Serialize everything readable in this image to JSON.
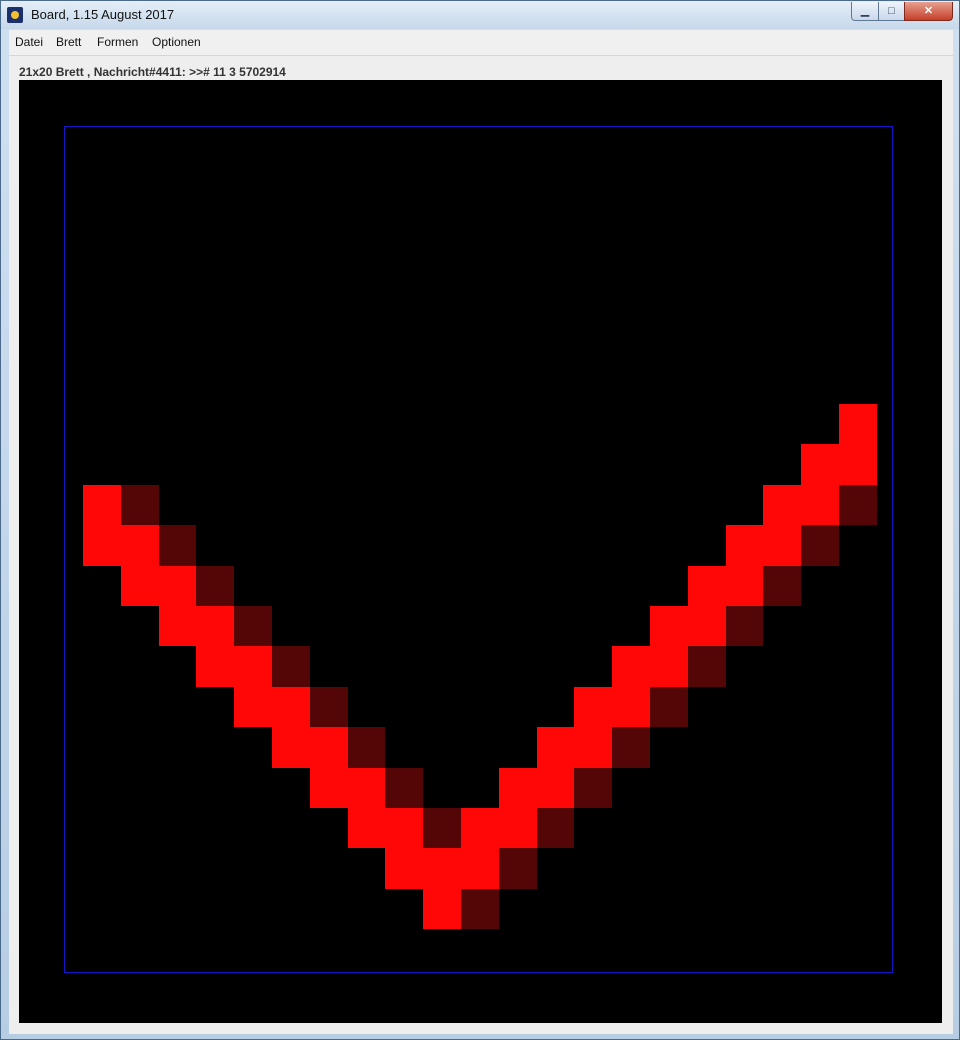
{
  "window": {
    "title": "Board, 1.15 August 2017",
    "controls": {
      "minimize": "▁",
      "maximize": "□",
      "close": "✕"
    }
  },
  "menu": [
    "Datei",
    "Brett",
    "Formen",
    "Optionen"
  ],
  "status": "21x20 Brett , Nachricht#4411: >># 11 3 5702914",
  "board": {
    "columns": 21,
    "rows": 20,
    "background": "#000000",
    "border_color": "#1515c8",
    "colors": {
      "bright": "#ff0707",
      "dark": "#540606"
    },
    "bright_cells": [
      [
        0,
        5
      ],
      [
        0,
        6
      ],
      [
        1,
        6
      ],
      [
        1,
        7
      ],
      [
        2,
        7
      ],
      [
        2,
        8
      ],
      [
        3,
        8
      ],
      [
        3,
        9
      ],
      [
        4,
        9
      ],
      [
        4,
        10
      ],
      [
        5,
        10
      ],
      [
        5,
        11
      ],
      [
        6,
        11
      ],
      [
        6,
        12
      ],
      [
        7,
        12
      ],
      [
        7,
        13
      ],
      [
        8,
        13
      ],
      [
        8,
        14
      ],
      [
        9,
        14
      ],
      [
        9,
        15
      ],
      [
        10,
        13
      ],
      [
        10,
        14
      ],
      [
        11,
        12
      ],
      [
        11,
        13
      ],
      [
        12,
        11
      ],
      [
        12,
        12
      ],
      [
        13,
        10
      ],
      [
        13,
        11
      ],
      [
        14,
        9
      ],
      [
        14,
        10
      ],
      [
        15,
        8
      ],
      [
        15,
        9
      ],
      [
        16,
        7
      ],
      [
        16,
        8
      ],
      [
        17,
        6
      ],
      [
        17,
        7
      ],
      [
        18,
        5
      ],
      [
        18,
        6
      ],
      [
        19,
        4
      ],
      [
        19,
        5
      ],
      [
        20,
        3
      ],
      [
        20,
        4
      ]
    ],
    "dark_cells": [
      [
        1,
        5
      ],
      [
        2,
        6
      ],
      [
        3,
        7
      ],
      [
        4,
        8
      ],
      [
        5,
        9
      ],
      [
        6,
        10
      ],
      [
        7,
        11
      ],
      [
        8,
        12
      ],
      [
        9,
        13
      ],
      [
        10,
        15
      ],
      [
        11,
        14
      ],
      [
        12,
        13
      ],
      [
        13,
        12
      ],
      [
        14,
        11
      ],
      [
        15,
        10
      ],
      [
        16,
        9
      ],
      [
        17,
        8
      ],
      [
        18,
        7
      ],
      [
        19,
        6
      ],
      [
        20,
        5
      ]
    ]
  }
}
